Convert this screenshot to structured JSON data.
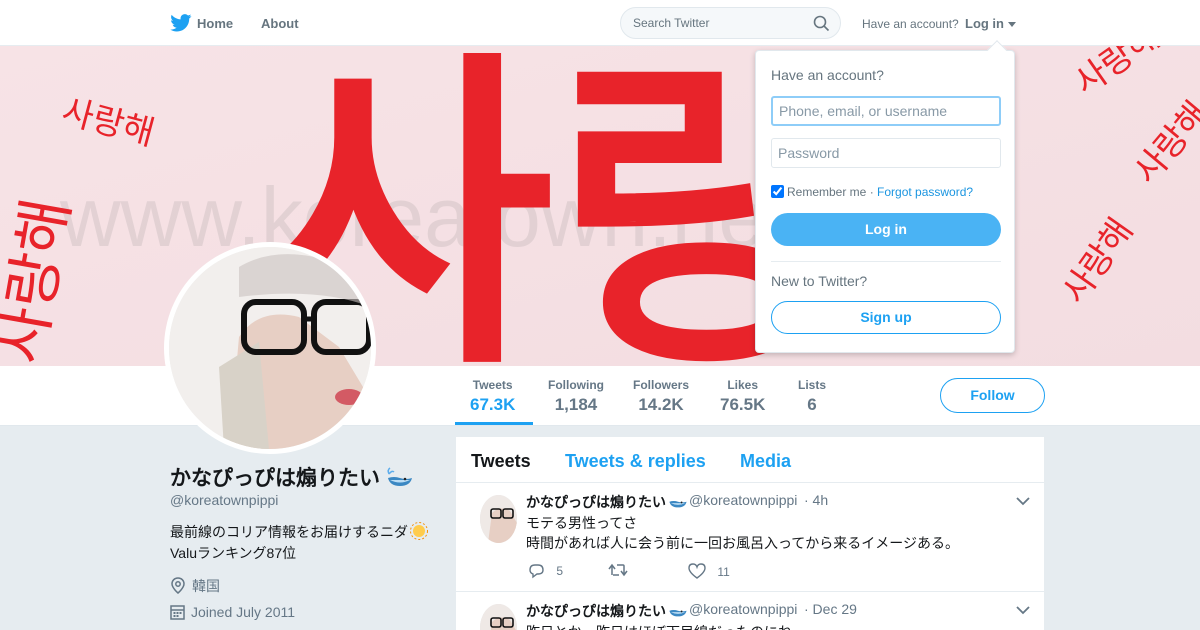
{
  "colors": {
    "accent": "#1da1f2",
    "banner_red": "#e8232a",
    "login_button": "#4ab3f4"
  },
  "topbar": {
    "home": "Home",
    "about": "About",
    "search_placeholder": "Search Twitter",
    "have_account": "Have an account?",
    "login": "Log in"
  },
  "banner": {
    "text_big": "사랑",
    "text_small": "사랑해",
    "watermark": "www.koreatown.net"
  },
  "stats": [
    {
      "label": "Tweets",
      "value": "67.3K"
    },
    {
      "label": "Following",
      "value": "1,184"
    },
    {
      "label": "Followers",
      "value": "14.2K"
    },
    {
      "label": "Likes",
      "value": "76.5K"
    },
    {
      "label": "Lists",
      "value": "6"
    }
  ],
  "follow_label": "Follow",
  "profile": {
    "name": "かなぴっぴは煽りたい",
    "handle": "@koreatownpippi",
    "bio_line1": "最前線のコリア情報をお届けするニダ",
    "bio_line2": "Valuランキング87位",
    "location": "韓国",
    "joined": "Joined July 2011"
  },
  "timeline": {
    "tabs": [
      "Tweets",
      "Tweets & replies",
      "Media"
    ],
    "tweets": [
      {
        "name": "かなぴっぴは煽りたい",
        "handle": "@koreatownpippi",
        "time": "· 4h",
        "line1": "モテる男性ってさ",
        "line2": "時間があれば人に会う前に一回お風呂入ってから来るイメージある。",
        "replies": "5",
        "retweets": "",
        "likes": "11"
      },
      {
        "name": "かなぴっぴは煽りたい",
        "handle": "@koreatownpippi",
        "time": "· Dec 29",
        "line1": "昨日とか一昨日はほぼ下目線だったのにね",
        "line2": ""
      }
    ]
  },
  "login_dropdown": {
    "title": "Have an account?",
    "username_placeholder": "Phone, email, or username",
    "password_placeholder": "Password",
    "remember": "Remember me",
    "separator": " · ",
    "forgot": "Forgot password?",
    "login_button": "Log in",
    "new_to": "New to Twitter?",
    "signup": "Sign up"
  }
}
